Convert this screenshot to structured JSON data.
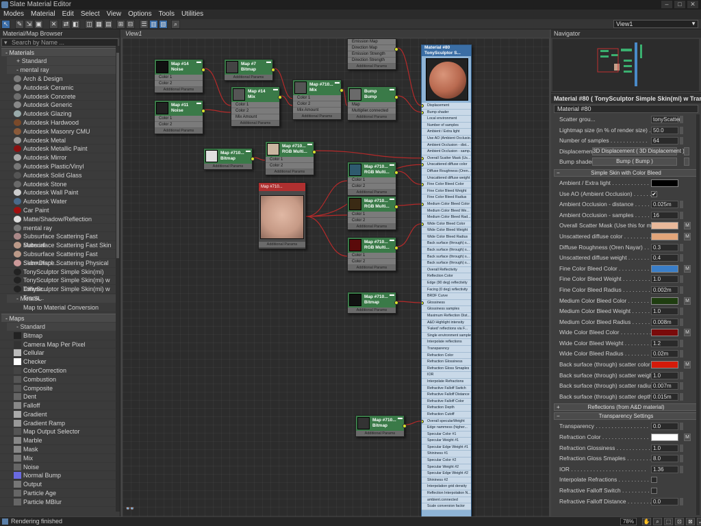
{
  "window": {
    "title": "Slate Material Editor"
  },
  "menu": [
    "Modes",
    "Material",
    "Edit",
    "Select",
    "View",
    "Options",
    "Tools",
    "Utilities"
  ],
  "toolbar": {
    "view_selector": "View1"
  },
  "browser": {
    "title": "Material/Map Browser",
    "search_placeholder": "Search by Name ...",
    "materials_group": "- Materials",
    "standard_sub": "+ Standard",
    "mentalray_sub": "- mental ray",
    "materials": [
      "Arch & Design",
      "Autodesk Ceramic",
      "Autodesk Concrete",
      "Autodesk Generic",
      "Autodesk Glazing",
      "Autodesk Hardwood",
      "Autodesk Masonry CMU",
      "Autodesk Metal",
      "Autodesk Metallic Paint",
      "Autodesk Mirror",
      "Autodesk Plastic/Vinyl",
      "Autodesk Solid Glass",
      "Autodesk Stone",
      "Autodesk Wall Paint",
      "Autodesk Water",
      "Car Paint",
      "Matte/Shadow/Reflection",
      "mental ray",
      "Subsurface Scattering Fast Material",
      "Subsurface Scattering Fast Skin",
      "Subsurface Scattering Fast Skin+Displ...",
      "Subsurface Scattering Physical",
      "TonySculptor Simple Skin(mi)",
      "TonySculptor Simple Skin(mi) w Diffuse...",
      "TonySculptor Simple Skin(mi) w Trans..."
    ],
    "metasl_sub": "- MetaSL",
    "metasl_items": [
      "Map to Material Conversion"
    ],
    "maps_group": "- Maps",
    "maps_standard_sub": "- Standard",
    "maps": [
      "Bitmap",
      "Camera Map Per Pixel",
      "Cellular",
      "Checker",
      "ColorCorrection",
      "Combustion",
      "Composite",
      "Dent",
      "Falloff",
      "Gradient",
      "Gradient Ramp",
      "Map Output Selector",
      "Marble",
      "Mask",
      "Mix",
      "Noise",
      "Normal Bump",
      "Output",
      "Particle Age",
      "Particle MBlur"
    ]
  },
  "view": {
    "tab": "View1",
    "nodes": [
      {
        "id": "n1",
        "title": "Map #14",
        "sub": "Noise",
        "slots": [
          "Color 1",
          "Color 2"
        ],
        "thumb": "#111111"
      },
      {
        "id": "n2",
        "title": "Map #7",
        "sub": "Bitmap",
        "slots": [],
        "thumb": "#444444"
      },
      {
        "id": "n3",
        "title": "Map #14",
        "sub": "Mix",
        "slots": [
          "Color 1",
          "Color 2",
          "Mix Amount"
        ],
        "thumb": "#555555"
      },
      {
        "id": "n4",
        "title": "Map #11",
        "sub": "Noise",
        "slots": [
          "Color 1",
          "Color 2"
        ],
        "thumb": "#222222"
      },
      {
        "id": "n5",
        "title": "Map #710...",
        "sub": "Mix",
        "slots": [
          "Color 1",
          "Color 2",
          "Mix Amount"
        ],
        "thumb": "#555555"
      },
      {
        "id": "n6",
        "title": "Bump",
        "sub": "Bump",
        "slots": [
          "Map",
          "Multiplier.connected"
        ],
        "thumb": "#6a6a6a"
      },
      {
        "id": "n7",
        "title": "Map #710...",
        "sub": "Bitmap",
        "slots": [],
        "thumb": "#e0e0e0"
      },
      {
        "id": "n8",
        "title": "Map #710...",
        "sub": "RGB Multi...",
        "slots": [
          "Color 1",
          "Color 2"
        ],
        "thumb": "#c9b6a0"
      },
      {
        "id": "n9",
        "title": "Map #710...",
        "sub": "RGB Multi...",
        "slots": [
          "Color 1",
          "Color 2"
        ],
        "thumb": "#2e5a6e"
      },
      {
        "id": "n10",
        "title": "Map #710...",
        "sub": "RGB Multi...",
        "slots": [
          "Color 1",
          "Color 2"
        ],
        "thumb": "#3a2a14"
      },
      {
        "id": "n11",
        "title": "Map #710...",
        "sub": "RGB Multi...",
        "slots": [
          "Color 1",
          "Color 2"
        ],
        "thumb": "#5a0a0a"
      },
      {
        "id": "n12",
        "title": "Map #710...",
        "sub": "Bitmap",
        "slots": [],
        "thumb": "#111111"
      },
      {
        "id": "n13",
        "title": "Map #710...",
        "sub": "Bitmap",
        "slots": [],
        "thumb": "#333333"
      },
      {
        "id": "n14",
        "title": "",
        "sub": "",
        "slots": [
          "Emission Map",
          "Direction Map",
          "Emission Strength",
          "Direction Strength"
        ],
        "thumb": "#555555"
      }
    ],
    "additional_params": "Additional Params",
    "big_bitmap_label": "Map #710...",
    "material": {
      "title": "Material #80",
      "sub": "TonySculptor  S...",
      "slots": [
        "Displacement",
        "Bump shader",
        "Local environment",
        "Number of samples",
        "Ambient / Extra light",
        "Use AO (Ambient Occlusio...",
        "Ambient Occlusion - dist...",
        "Ambient Occlusion - samp...",
        "Overall Scatter Mask (Us...",
        "Unscattered diffuse color",
        "Diffuse Roughness (Oren...",
        "Unscattered diffuse weight",
        "Fine Color Bleed Color",
        "Fine Color Bleed Weight",
        "Fine Color Bleed Radius",
        "Medium Color Bleed Color",
        "Medium Color Bleed We...",
        "Medium Color Bleed Rad...",
        "Wide Color Bleed Color",
        "Wide Color Bleed Weight",
        "Wide Color Bleed Radius",
        "Back surface (through) s...",
        "Back surface (through) s...",
        "Back surface (through) s...",
        "Back surface (through) s...",
        "Overall Reflectivity",
        "Reflection Color",
        "Edge (90 deg) reflectivity",
        "Facing (0 deg) reflectivity",
        "BRDF Curve",
        "Glossiness",
        "Glossiness samples",
        "Maximum Reflection Dist...",
        "A&D Highlight intensity",
        "'Faked' reflections via F...",
        "Single environment sample",
        "Interpolate reflections",
        "Transparency",
        "Refraction Color",
        "Refraction Glossiness",
        "Refraction Gloss Smaples",
        "IOR",
        "Interpolate Refractions",
        "Refractive Falloff Switch",
        "Refractive Falloff Distance",
        "Refractive Falloff Color",
        "Refraction Depth",
        "Refraction Cutoff",
        "Overall specularWeight",
        "Edge nammess (higher...",
        "Specular Color #1",
        "Specular Weight #1",
        "Specular Edge Weight #1",
        "Shininess #1",
        "Specular Color #2",
        "Specular Weight #2",
        "Specular Edge Weight #2",
        "Shininess #2",
        "Interpolation grid density",
        "Reflection Interpolation N...",
        "ambient.connected",
        "Scale conversion factor"
      ]
    }
  },
  "navigator": {
    "title": "Navigator"
  },
  "params": {
    "title": "Material #80  ( TonySculptor Simple Skin(mi) w Tran...",
    "name_field": "Material #80",
    "top_rows": [
      {
        "label": "Scatter grou...",
        "value": "tonyScatter"
      },
      {
        "label": "Lightmap size (in % of render size) . . . . .",
        "value": "50.0"
      },
      {
        "label": "Number of samples . . . . . . . . . . . .",
        "value": "64"
      }
    ],
    "displacement_label": "Displacement . .",
    "displacement_btn": "3D Displacement  ( 3D Displacement )",
    "bump_label": "Bump shader . .",
    "bump_btn": "Bump  ( Bump )",
    "rollout1": "Simple Skin with Color Bleed",
    "skin_rows": [
      {
        "label": "Ambient / Extra light . . . . . . . . . . . .",
        "kind": "swatch",
        "color": "#000000"
      },
      {
        "label": "Use AO (Ambient Occlusion) . . . . . . . .",
        "kind": "check",
        "value": "✔"
      },
      {
        "label": "Ambient Occlusion - distance . . . . . . . .",
        "kind": "value",
        "value": "0.025m"
      },
      {
        "label": "Ambient Occlusion - samples . . . . . . . .",
        "kind": "value",
        "value": "16"
      },
      {
        "label": "Overall Scatter Mask (Use this for makeu...",
        "kind": "swatch",
        "color": "#e8b89a",
        "m": true
      },
      {
        "label": "Unscattered diffuse color . . . . . . . . . .",
        "kind": "swatch",
        "color": "#e2a57a",
        "m": true
      },
      {
        "label": "Diffuse Roughness (Oren Nayar) . . . . .",
        "kind": "value",
        "value": "0.3"
      },
      {
        "label": "Unscattered diffuse weight . . . . . . . .",
        "kind": "value",
        "value": "0.4"
      },
      {
        "label": "Fine Color Bleed Color . . . . . . . . . . . .",
        "kind": "swatch",
        "color": "#3a7ec8",
        "m": true
      },
      {
        "label": "Fine Color Bleed Weight . . . . . . . . . . .",
        "kind": "value",
        "value": "1.0"
      },
      {
        "label": "Fine Color Bleed Radius . . . . . . . . . . .",
        "kind": "value",
        "value": "0.002m"
      },
      {
        "label": "Medium Color Bleed Color . . . . . . . . . .",
        "kind": "swatch",
        "color": "#1f3d10",
        "m": true
      },
      {
        "label": "Medium Color Bleed Weight . . . . . . . . .",
        "kind": "value",
        "value": "1.0"
      },
      {
        "label": "Medium Color Bleed Radius . . . . . . . . .",
        "kind": "value",
        "value": "0.008m"
      },
      {
        "label": "Wide Color Bleed Color . . . . . . . . . . . .",
        "kind": "swatch",
        "color": "#7a0a0a",
        "m": true
      },
      {
        "label": "Wide Color Bleed Weight . . . . . . . . . . .",
        "kind": "value",
        "value": "1.2"
      },
      {
        "label": "Wide Color Bleed Radius . . . . . . . . . . .",
        "kind": "value",
        "value": "0.02m"
      },
      {
        "label": "Back surface (through) scatter color . . . .",
        "kind": "swatch",
        "color": "#d41a0a",
        "m": true
      },
      {
        "label": "Back surface (through) scatter weight . . .",
        "kind": "value",
        "value": "1.0"
      },
      {
        "label": "Back surface (through) scatter radius . . .",
        "kind": "value",
        "value": "0.007m"
      },
      {
        "label": "Back surface (through) scatter depth . . .",
        "kind": "value",
        "value": "0.015m"
      }
    ],
    "rollout2": "Reflections (from A&D material)",
    "rollout3": "Transparency Settings",
    "trans_rows": [
      {
        "label": "Transparency . . . . . . . . . . . . . . . . .",
        "kind": "value",
        "value": "0.0"
      },
      {
        "label": "Refraction Color . . . . . . . . . . . . . . .",
        "kind": "swatch",
        "color": "#ffffff",
        "m": true
      },
      {
        "label": "Refraction Glossiness . . . . . . . . . . . .",
        "kind": "value",
        "value": "1.0"
      },
      {
        "label": "Refraction Gloss Smaples . . . . . . . . . .",
        "kind": "value",
        "value": "8.0"
      },
      {
        "label": "IOR . . . . . . . . . . . . . . . . . . . . . . . .",
        "kind": "value",
        "value": "1.36"
      },
      {
        "label": "Interpolate Refractions . . . . . . . . . . .",
        "kind": "check",
        "value": ""
      },
      {
        "label": "Refractive Falloff Switch . . . . . . . . . . .",
        "kind": "check",
        "value": ""
      },
      {
        "label": "Refractive Falloff Distance . . . . . . . . .",
        "kind": "value",
        "value": "0.0"
      }
    ]
  },
  "status": {
    "message": "Rendering finished",
    "zoom": "78%"
  }
}
